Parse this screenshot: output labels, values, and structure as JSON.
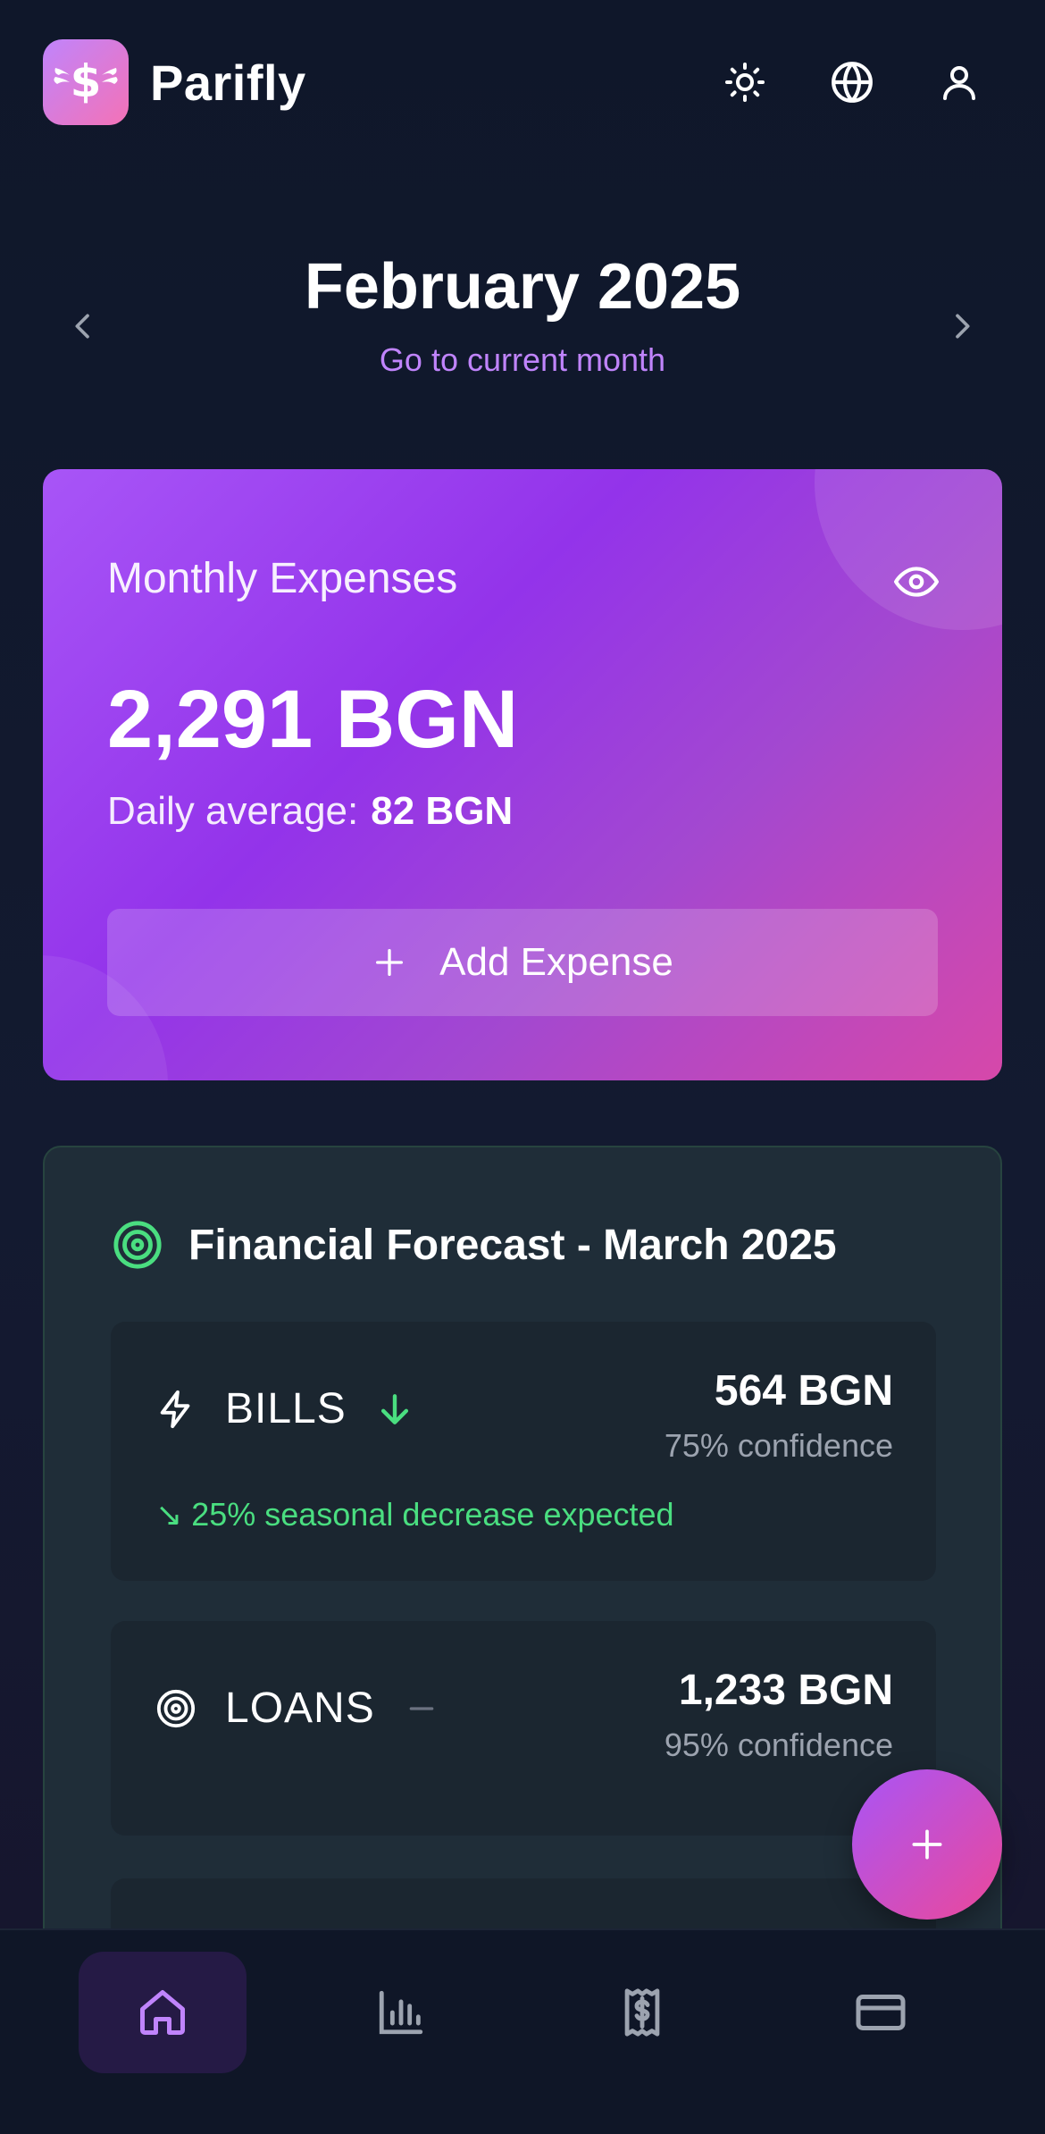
{
  "app": {
    "name": "Parifly"
  },
  "month_nav": {
    "title": "February 2025",
    "current_link": "Go to current month"
  },
  "expenses_card": {
    "label": "Monthly Expenses",
    "amount": "2,291 BGN",
    "daily_label": "Daily average:",
    "daily_value": "82 BGN",
    "add_button": "Add Expense"
  },
  "forecast": {
    "title": "Financial Forecast - March 2025",
    "items": [
      {
        "name": "BILLS",
        "amount": "564 BGN",
        "confidence": "75% confidence",
        "note": "25% seasonal decrease expected",
        "trend": "down"
      },
      {
        "name": "LOANS",
        "amount": "1,233 BGN",
        "confidence": "95% confidence",
        "trend": "flat"
      }
    ]
  },
  "colors": {
    "accent": "#a855f7",
    "pink": "#ec4899",
    "positive": "#4ade80",
    "link": "#c084fc"
  },
  "icons": [
    "dollar-wings-logo",
    "sun-icon",
    "globe-icon",
    "user-icon",
    "chevron-left-icon",
    "chevron-right-icon",
    "eye-icon",
    "plus-icon",
    "target-icon",
    "bolt-icon",
    "arrow-down-icon",
    "minus-icon",
    "home-icon",
    "bar-chart-icon",
    "receipt-icon",
    "credit-card-icon"
  ]
}
